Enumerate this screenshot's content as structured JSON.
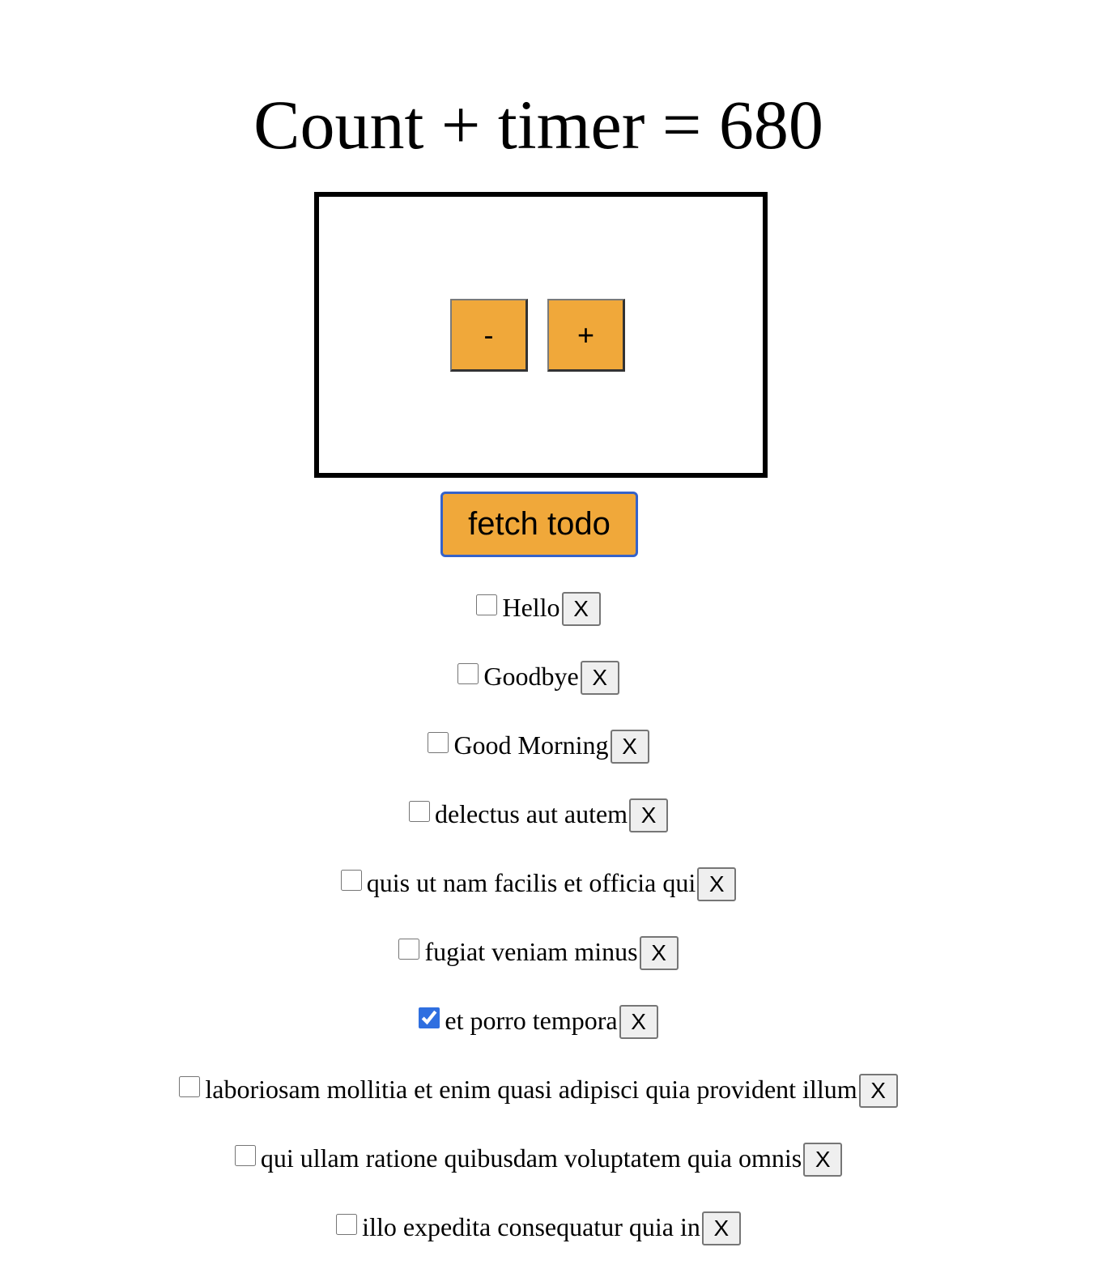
{
  "page": {
    "title": "Count + timer = 680"
  },
  "counter": {
    "decrement_label": "-",
    "increment_label": "+"
  },
  "fetch_button": {
    "label": "fetch todo"
  },
  "todos": [
    {
      "text": "Hello",
      "completed": false,
      "delete_label": "X"
    },
    {
      "text": "Goodbye",
      "completed": false,
      "delete_label": "X"
    },
    {
      "text": "Good Morning",
      "completed": false,
      "delete_label": "X"
    },
    {
      "text": "delectus aut autem",
      "completed": false,
      "delete_label": "X"
    },
    {
      "text": "quis ut nam facilis et officia qui",
      "completed": false,
      "delete_label": "X"
    },
    {
      "text": "fugiat veniam minus",
      "completed": false,
      "delete_label": "X"
    },
    {
      "text": "et porro tempora",
      "completed": true,
      "delete_label": "X"
    },
    {
      "text": "laboriosam mollitia et enim quasi adipisci quia provident illum",
      "completed": false,
      "delete_label": "X"
    },
    {
      "text": "qui ullam ratione quibusdam voluptatem quia omnis",
      "completed": false,
      "delete_label": "X"
    },
    {
      "text": "illo expedita consequatur quia in",
      "completed": false,
      "delete_label": "X"
    }
  ],
  "colors": {
    "button_accent": "#f0a83a",
    "focus_border": "#3563c9",
    "checkbox_checked": "#2f6fe0"
  }
}
